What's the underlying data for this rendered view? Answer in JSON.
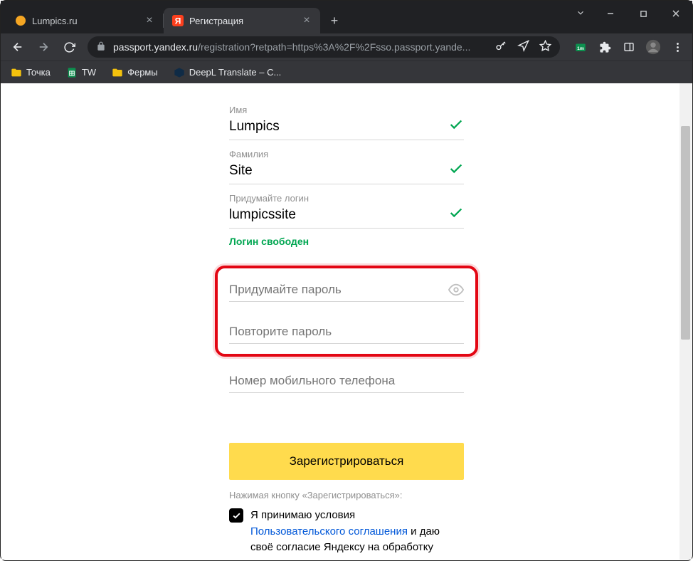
{
  "browser": {
    "tabs": [
      {
        "title": "Lumpics.ru",
        "active": false
      },
      {
        "title": "Регистрация",
        "active": true
      }
    ],
    "url_host": "passport.yandex.ru",
    "url_path": "/registration?retpath=https%3A%2F%2Fsso.passport.yande..."
  },
  "bookmarks": [
    {
      "label": "Точка",
      "icon": "folder-yellow"
    },
    {
      "label": "TW",
      "icon": "sheets"
    },
    {
      "label": "Фермы",
      "icon": "folder-yellow"
    },
    {
      "label": "DeepL Translate – C...",
      "icon": "deepl"
    }
  ],
  "form": {
    "firstname_label": "Имя",
    "firstname_value": "Lumpics",
    "lastname_label": "Фамилия",
    "lastname_value": "Site",
    "login_label": "Придумайте логин",
    "login_value": "lumpicssite",
    "login_status": "Логин свободен",
    "password_placeholder": "Придумайте пароль",
    "password_confirm_placeholder": "Повторите пароль",
    "phone_placeholder": "Номер мобильного телефона",
    "register_button": "Зарегистрироваться",
    "consent_title": "Нажимая кнопку «Зарегистрироваться»:",
    "consent_prefix": "Я принимаю условия ",
    "consent_link": "Пользовательского соглашения",
    "consent_suffix": " и даю своё согласие Яндексу на обработку"
  }
}
